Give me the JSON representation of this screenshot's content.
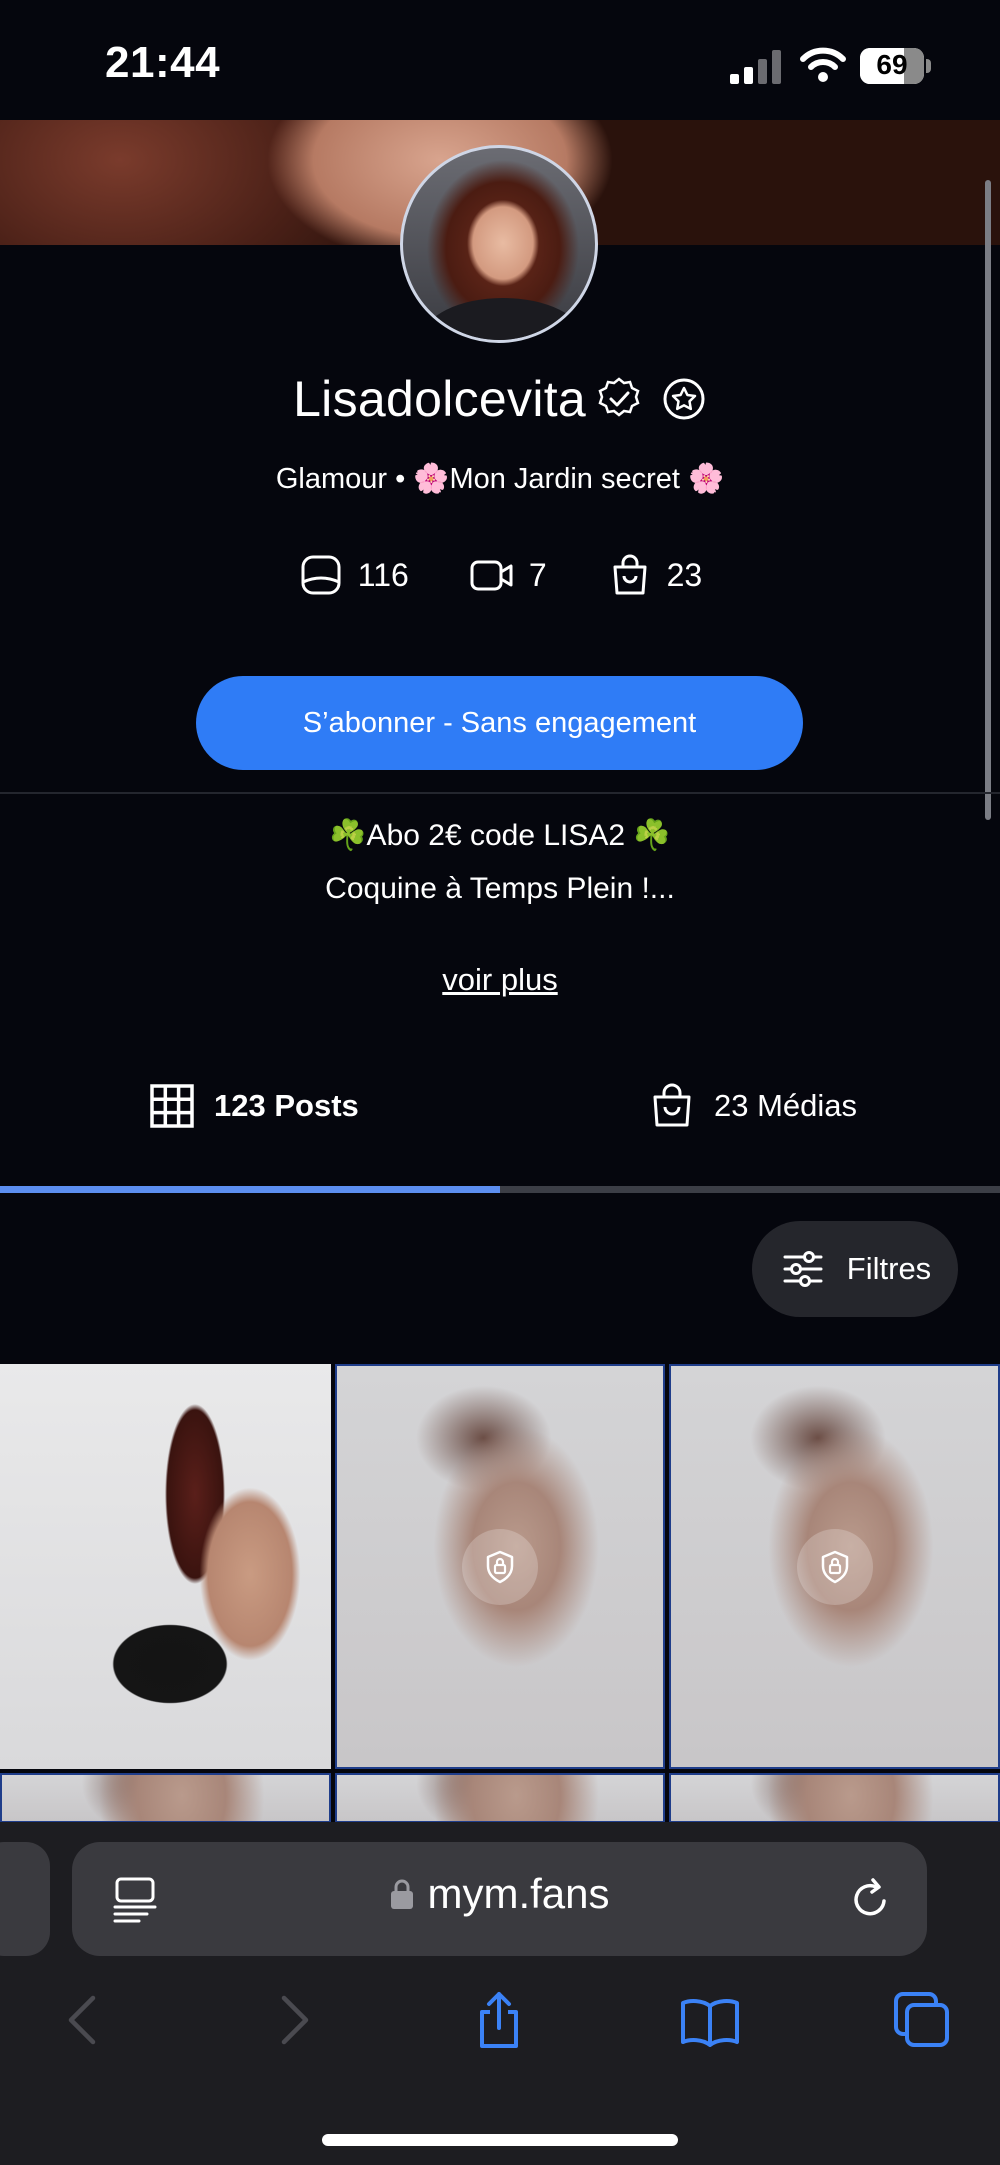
{
  "status_bar": {
    "time": "21:44",
    "battery": "69",
    "battery_level": 0.69
  },
  "profile": {
    "username": "Lisadolcevita",
    "subtitle": "Glamour • 🌸Mon Jardin secret 🌸",
    "stats": {
      "photos": "116",
      "videos": "7",
      "medias": "23"
    },
    "subscribe_label": "S’abonner - Sans engagement",
    "bio_line1": "☘️Abo 2€ code LISA2 ☘️",
    "bio_line2": "Coquine à Temps Plein !...",
    "see_more": "voir plus"
  },
  "tabs": {
    "posts": "123 Posts",
    "medias": "23 Médias",
    "active": "posts"
  },
  "filters_label": "Filtres",
  "browser": {
    "url": "mym.fans"
  },
  "colors": {
    "accent": "#2f7cf6",
    "background": "#05060d",
    "tab_indicator": "#5c8ef0"
  }
}
